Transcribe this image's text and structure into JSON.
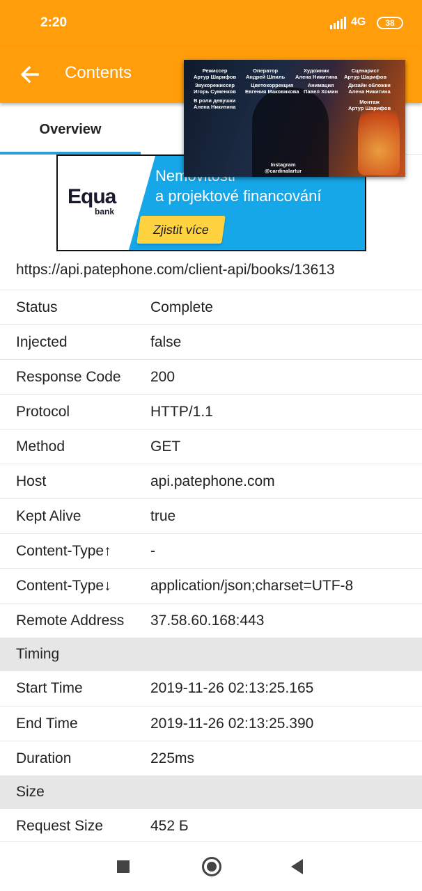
{
  "status_bar": {
    "time": "2:20",
    "network": "4G",
    "battery": "38"
  },
  "app_bar": {
    "back_icon": "arrow-left-icon",
    "title": "Contents"
  },
  "tabs": [
    {
      "label": "Overview",
      "active": true
    },
    {
      "label": "",
      "active": false
    }
  ],
  "video_overlay": {
    "credits": [
      {
        "role": "Режиссер",
        "name": "Артур Шарифов"
      },
      {
        "role": "Оператор",
        "name": "Андрей Шпиль"
      },
      {
        "role": "Художник",
        "name": "Алена Никитина"
      },
      {
        "role": "Сценарист",
        "name": "Артур Шарифов"
      },
      {
        "role": "Звукорежиссер",
        "name": "Игорь Суменков"
      },
      {
        "role": "Цветокоррекция",
        "name": "Евгения Маковикова"
      },
      {
        "role": "Анимация",
        "name": "Павел Хомин"
      },
      {
        "role": "Дизайн обложки",
        "name": "Алена Никитина"
      },
      {
        "role": "В роли девушки",
        "name": "Алена Никитина"
      },
      {
        "role": "Монтаж",
        "name": "Артур Шарифов"
      }
    ],
    "instagram_label": "Instagram",
    "instagram_handle": "@cardinalartur"
  },
  "ad": {
    "logo": "Equa",
    "logo_sub": "bank",
    "headline_1": "Nemovitosti",
    "headline_2": "a projektové financování",
    "cta": "Zjistit více"
  },
  "url": "https://api.patephone.com/client-api/books/13613",
  "overview": [
    {
      "label": "Status",
      "value": "Complete"
    },
    {
      "label": "Injected",
      "value": "false"
    },
    {
      "label": "Response Code",
      "value": "200"
    },
    {
      "label": "Protocol",
      "value": "HTTP/1.1"
    },
    {
      "label": "Method",
      "value": "GET"
    },
    {
      "label": "Host",
      "value": "api.patephone.com"
    },
    {
      "label": "Kept Alive",
      "value": "true"
    },
    {
      "label": "Content-Type↑",
      "value": "-"
    },
    {
      "label": "Content-Type↓",
      "value": "application/json;charset=UTF-8"
    },
    {
      "label": "Remote Address",
      "value": "37.58.60.168:443"
    }
  ],
  "timing": {
    "section_label": "Timing",
    "rows": [
      {
        "label": "Start Time",
        "value": "2019-11-26 02:13:25.165"
      },
      {
        "label": "End Time",
        "value": "2019-11-26 02:13:25.390"
      },
      {
        "label": "Duration",
        "value": "225ms"
      }
    ]
  },
  "size": {
    "section_label": "Size",
    "rows": [
      {
        "label": "Request Size",
        "value": "452 Б"
      }
    ]
  },
  "nav_bar": {
    "recents_icon": "square-icon",
    "home_icon": "circle-icon",
    "back_icon": "triangle-back-icon"
  }
}
